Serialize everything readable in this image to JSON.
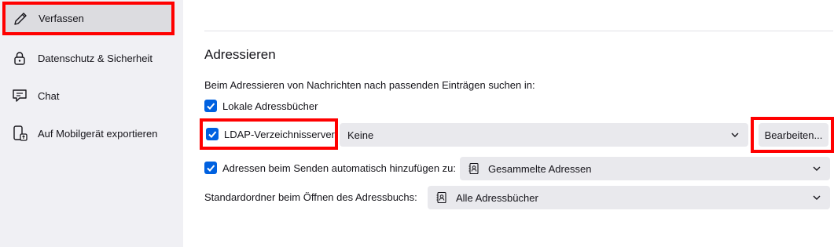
{
  "sidebar": {
    "items": [
      {
        "label": "Verfassen",
        "icon": "pencil-icon",
        "active": true
      },
      {
        "label": "Datenschutz & Sicherheit",
        "icon": "lock-icon"
      },
      {
        "label": "Chat",
        "icon": "chat-bubble-icon"
      },
      {
        "label": "Auf Mobilgerät exportieren",
        "icon": "mobile-export-icon"
      }
    ]
  },
  "section": {
    "title": "Adressieren",
    "description": "Beim Adressieren von Nachrichten nach passenden Einträgen suchen in:"
  },
  "options": {
    "local_addressbooks": {
      "label": "Lokale Adressbücher",
      "checked": true
    },
    "ldap": {
      "label": "LDAP-Verzeichnisserver:",
      "checked": true,
      "value": "Keine",
      "edit_button": "Bearbeiten..."
    },
    "auto_add": {
      "label": "Adressen beim Senden automatisch hinzufügen zu:",
      "checked": true,
      "value": "Gesammelte Adressen"
    },
    "default_folder": {
      "label": "Standardordner beim Öffnen des Adressbuchs:",
      "value": "Alle Adressbücher"
    }
  },
  "colors": {
    "accent": "#0061e0",
    "highlight": "#ff0000"
  }
}
